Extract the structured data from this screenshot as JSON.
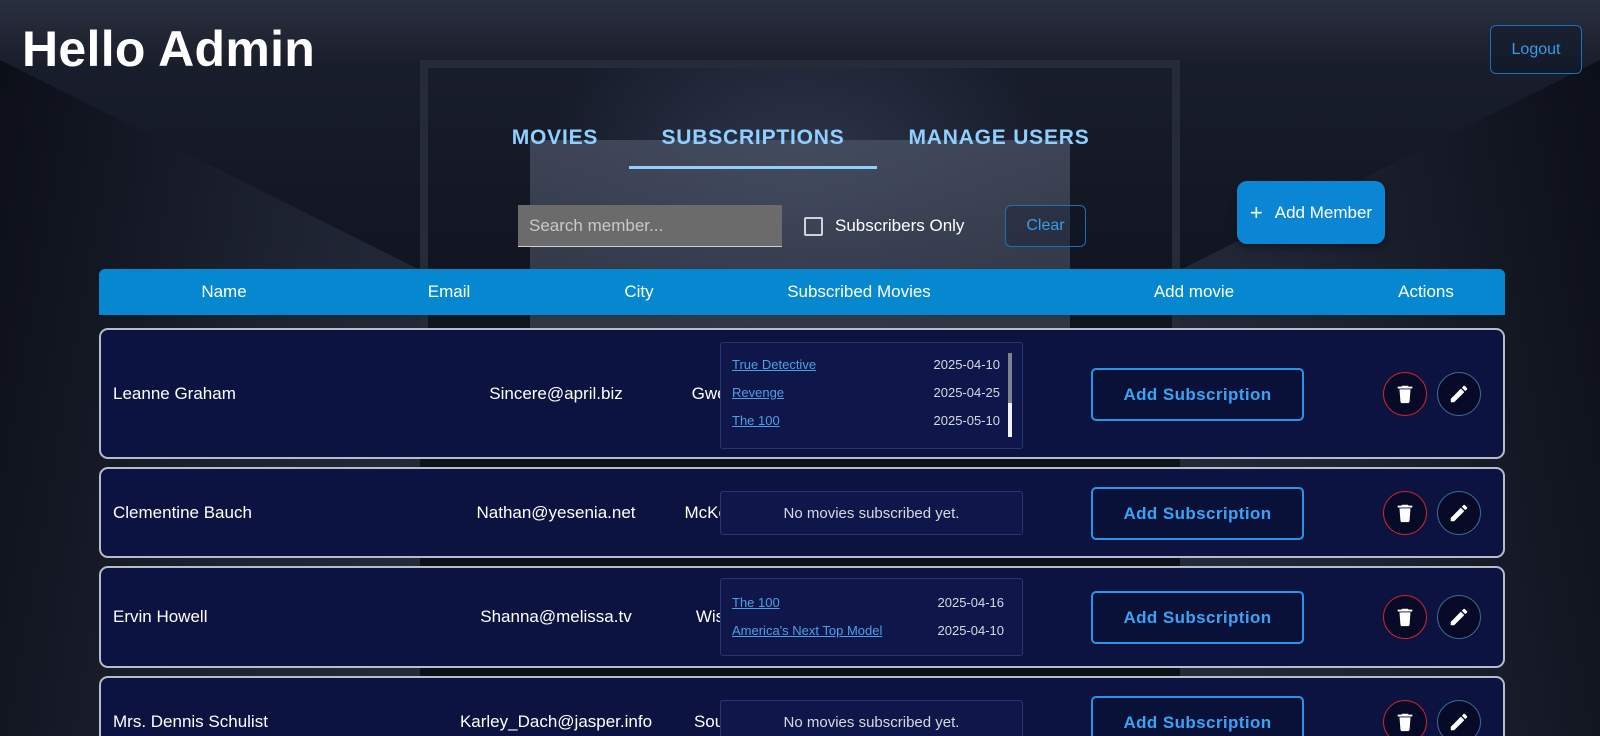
{
  "header": {
    "greeting": "Hello Admin",
    "logout_label": "Logout"
  },
  "tabs": [
    {
      "label": "MOVIES",
      "active": false
    },
    {
      "label": "SUBSCRIPTIONS",
      "active": true
    },
    {
      "label": "MANAGE USERS",
      "active": false
    }
  ],
  "filters": {
    "search_placeholder": "Search member...",
    "search_value": "",
    "subscribers_only_label": "Subscribers Only",
    "subscribers_only_checked": false,
    "clear_label": "Clear"
  },
  "add_member": {
    "icon": "plus-icon",
    "label": "Add Member"
  },
  "table": {
    "columns": [
      "Name",
      "Email",
      "City",
      "Subscribed Movies",
      "Add movie",
      "Actions"
    ],
    "empty_text": "No movies subscribed yet.",
    "add_subscription_label": "Add Subscription",
    "rows": [
      {
        "name": "Leanne Graham",
        "email": "Sincere@april.biz",
        "city": "Gwenborough",
        "movies": [
          {
            "title": "True Detective",
            "date": "2025-04-10"
          },
          {
            "title": "Revenge",
            "date": "2025-04-25"
          },
          {
            "title": "The 100",
            "date": "2025-05-10"
          }
        ]
      },
      {
        "name": "Clementine Bauch",
        "email": "Nathan@yesenia.net",
        "city": "McKenziehaven",
        "movies": []
      },
      {
        "name": "Ervin Howell",
        "email": "Shanna@melissa.tv",
        "city": "Wisokyburgh",
        "movies": [
          {
            "title": "The 100",
            "date": "2025-04-16"
          },
          {
            "title": "America's Next Top Model",
            "date": "2025-04-10"
          }
        ]
      },
      {
        "name": "Mrs. Dennis Schulist",
        "email": "Karley_Dach@jasper.info",
        "city": "South Christy",
        "movies": []
      }
    ]
  },
  "icons": {
    "delete": "trash-icon",
    "edit": "pencil-icon"
  },
  "colors": {
    "accent": "#0688d0",
    "link": "#4e9fe6",
    "delete": "#d4262e",
    "row_bg": "#0d1340"
  }
}
